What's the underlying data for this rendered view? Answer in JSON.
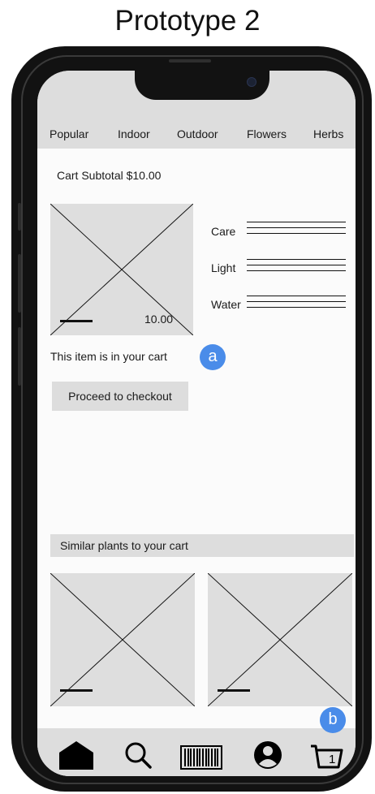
{
  "page_title": "Prototype 2",
  "categories": [
    "Popular",
    "Indoor",
    "Outdoor",
    "Flowers",
    "Herbs"
  ],
  "cart": {
    "subtotal_label": "Cart Subtotal $10.00",
    "item_price": "10.00",
    "in_cart_text": "This item is in your cart",
    "checkout_label": "Proceed to checkout"
  },
  "attributes": [
    "Care",
    "Light",
    "Water"
  ],
  "annotations": [
    "a",
    "b"
  ],
  "similar": {
    "heading": "Similar plants to your cart"
  },
  "bottom_nav": {
    "icons": [
      "home-icon",
      "search-icon",
      "barcode-icon",
      "profile-icon",
      "cart-icon"
    ],
    "cart_count": "1"
  },
  "colors": {
    "placeholder": "#dedede",
    "bar": "#dddddd",
    "annotation": "#4a8ce9",
    "phone": "#121212"
  }
}
